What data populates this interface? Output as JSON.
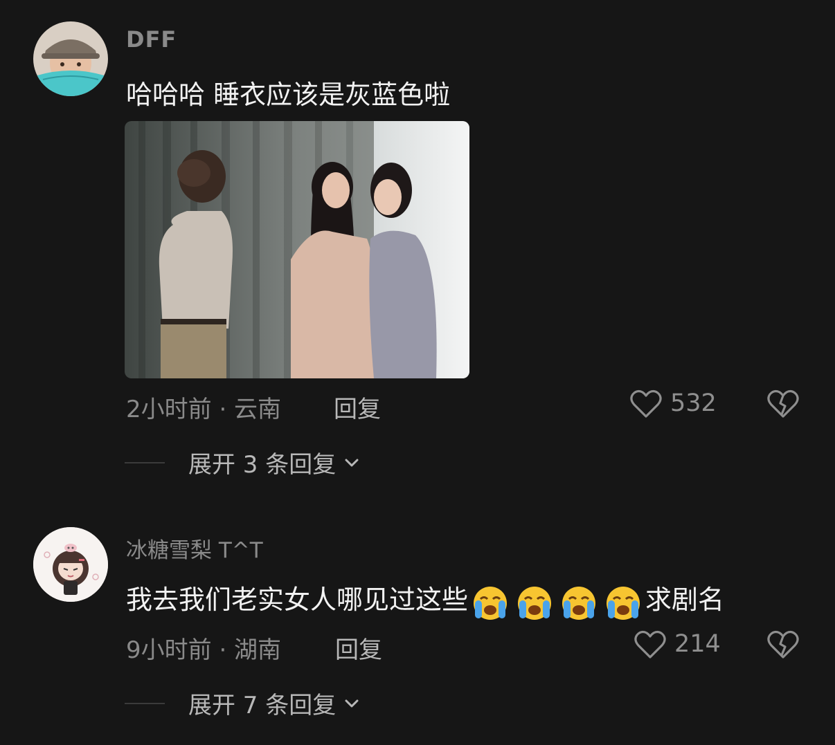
{
  "comments": [
    {
      "username": "DFF",
      "text": "哈哈哈 睡衣应该是灰蓝色啦",
      "time_location": "2小时前 · 云南",
      "reply_label": "回复",
      "likes": "532",
      "expand_label": "展开 3 条回复"
    },
    {
      "username": "冰糖雪梨 T^T",
      "text_before": "我去我们老实女人哪见过这些",
      "emojis": [
        "loudly-crying-face",
        "loudly-crying-face",
        "loudly-crying-face",
        "loudly-crying-face"
      ],
      "text_after": "求剧名",
      "time_location": "9小时前 · 湖南",
      "reply_label": "回复",
      "likes": "214",
      "expand_label": "展开 7 条回复"
    }
  ],
  "colors": {
    "background": "#161616",
    "text_primary": "#f2f2f2",
    "text_secondary": "#8a8a8a"
  }
}
